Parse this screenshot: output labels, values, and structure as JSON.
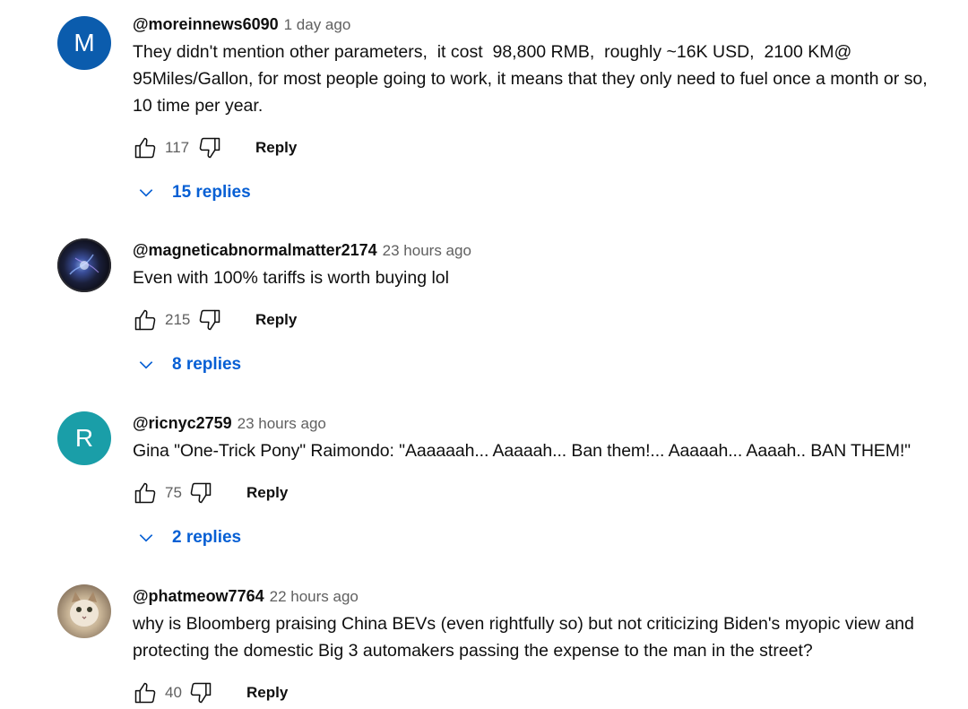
{
  "comments": [
    {
      "author": "@moreinnews6090",
      "time": "1 day ago",
      "avatar_letter": "M",
      "avatar_color": "#0b5cad",
      "text": "They didn't mention other parameters,  it cost  98,800 RMB,  roughly ~16K USD,  2100 KM@ 95Miles/Gallon, for most people going to work, it means that they only need to fuel once a month or so, 10 time per year.",
      "likes": "117",
      "reply_label": "Reply",
      "replies_label": "15 replies"
    },
    {
      "author": "@magneticabnormalmatter2174",
      "time": "23 hours ago",
      "avatar_image": "dark-nebula-avatar",
      "text": "Even with 100% tariffs is worth buying lol",
      "likes": "215",
      "reply_label": "Reply",
      "replies_label": "8 replies"
    },
    {
      "author": "@ricnyc2759",
      "time": "23 hours ago",
      "avatar_letter": "R",
      "avatar_color": "#1a9ea8",
      "text": "Gina \"One-Trick Pony\" Raimondo: \"Aaaaaah... Aaaaah... Ban them!... Aaaaah... Aaaah.. BAN THEM!\"",
      "likes": "75",
      "reply_label": "Reply",
      "replies_label": "2 replies"
    },
    {
      "author": "@phatmeow7764",
      "time": "22 hours ago",
      "avatar_image": "cat-photo-avatar",
      "text": "why is Bloomberg praising China BEVs (even rightfully so) but not criticizing Biden's myopic view and protecting the domestic Big 3 automakers passing the expense to the man in the street?",
      "likes": "40",
      "reply_label": "Reply"
    }
  ],
  "colors": {
    "link_blue": "#065fd4",
    "secondary_text": "#606060",
    "primary_text": "#0f0f0f"
  },
  "icons": {
    "like": "thumbs-up-icon",
    "dislike": "thumbs-down-icon",
    "expand": "chevron-down-icon"
  }
}
